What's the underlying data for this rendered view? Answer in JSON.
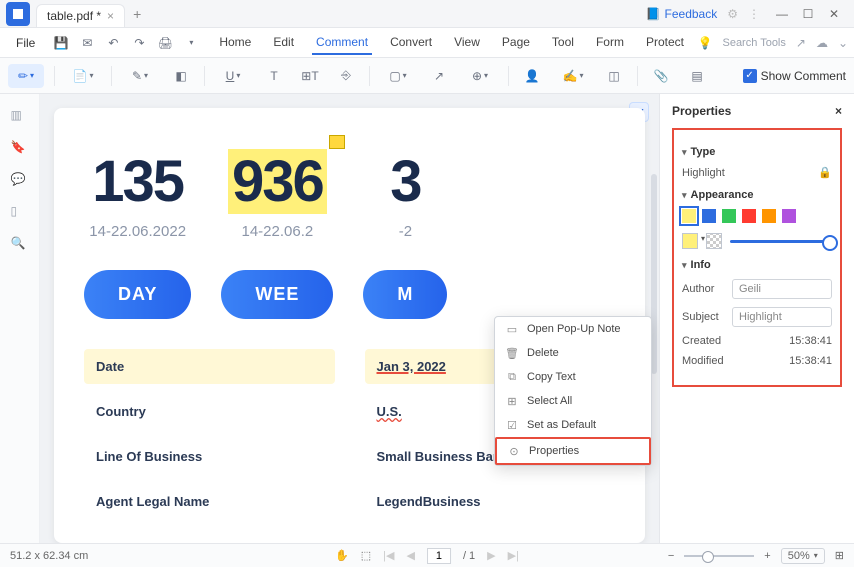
{
  "titlebar": {
    "tab_title": "table.pdf *",
    "feedback": "Feedback"
  },
  "menubar": {
    "file": "File",
    "items": [
      "Home",
      "Edit",
      "Comment",
      "Convert",
      "View",
      "Page",
      "Tool",
      "Form",
      "Protect"
    ],
    "search_placeholder": "Search Tools"
  },
  "toolbar": {
    "show_comment": "Show Comment"
  },
  "doc": {
    "cards": [
      {
        "value": "135",
        "range": "14-22.06.2022",
        "pill": "DAY"
      },
      {
        "value": "936",
        "range": "14-22.06.2",
        "pill": "WEE"
      },
      {
        "value": "3",
        "range": "-2",
        "pill": "M"
      }
    ],
    "table": {
      "left_header": "Date",
      "right_header": "Jan 3, 2022",
      "rows": [
        {
          "label": "Country",
          "value": "U.S."
        },
        {
          "label": "Line Of Business",
          "value": "Small Business Banking"
        },
        {
          "label": "Agent Legal Name",
          "value": "LegendBusiness"
        }
      ]
    }
  },
  "context_menu": {
    "items": [
      "Open Pop-Up Note",
      "Delete",
      "Copy Text",
      "Select All",
      "Set as Default",
      "Properties"
    ]
  },
  "properties": {
    "title": "Properties",
    "type_label": "Type",
    "type_value": "Highlight",
    "appearance_label": "Appearance",
    "colors": [
      "#fff07a",
      "#2d6cdf",
      "#34c759",
      "#ff3b30",
      "#ff9500",
      "#af52de"
    ],
    "info_label": "Info",
    "author_label": "Author",
    "author_value": "Geili",
    "subject_label": "Subject",
    "subject_value": "Highlight",
    "created_label": "Created",
    "created_value": "15:38:41",
    "modified_label": "Modified",
    "modified_value": "15:38:41"
  },
  "statusbar": {
    "dimensions": "51.2 x 62.34 cm",
    "page_current": "1",
    "page_total": "/ 1",
    "zoom": "50%"
  }
}
